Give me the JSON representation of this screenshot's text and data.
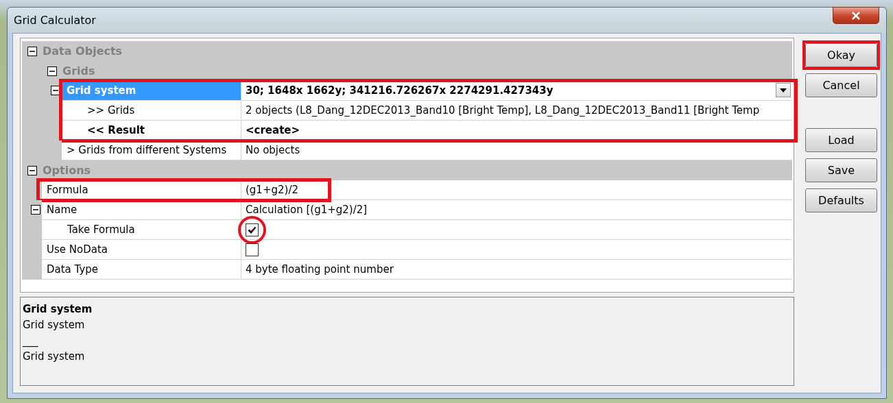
{
  "window": {
    "title": "Grid Calculator"
  },
  "properties": [
    {
      "kind": "category",
      "label": "Data Objects",
      "expanded": true,
      "children": [
        {
          "kind": "category",
          "label": "Grids",
          "expanded": true,
          "children": [
            {
              "kind": "dropdown",
              "label": "Grid system",
              "value": "30; 1648x 1662y; 341216.726267x 2274291.427343y",
              "bold": true,
              "selected": true,
              "expanded": true,
              "highlighted": true,
              "highlight_full_width": true,
              "children": [
                {
                  "kind": "text",
                  "label": ">> Grids",
                  "value": "2 objects (L8_Dang_12DEC2013_Band10 [Bright Temp], L8_Dang_12DEC2013_Band11 [Bright Temp",
                  "bold": false,
                  "selected": false,
                  "highlighted": true,
                  "highlight_full_width": true
                },
                {
                  "kind": "text",
                  "label": "<< Result",
                  "value": "<create>",
                  "bold": true,
                  "selected": false,
                  "highlighted": true,
                  "highlight_full_width": true
                }
              ]
            },
            {
              "kind": "text",
              "label": "> Grids from different Systems",
              "value": "No objects",
              "bold": false,
              "selected": false,
              "highlighted": false
            }
          ]
        }
      ]
    },
    {
      "kind": "category",
      "label": "Options",
      "expanded": true,
      "children": [
        {
          "kind": "text",
          "label": "Formula",
          "value": "(g1+g2)/2",
          "bold": false,
          "selected": false,
          "highlighted": true,
          "highlight_full_width": false
        },
        {
          "kind": "text",
          "label": "Name",
          "value": "Calculation [(g1+g2)/2]",
          "bold": false,
          "selected": false,
          "highlighted": false,
          "expanded": true,
          "children": [
            {
              "kind": "checkbox",
              "label": "Take Formula",
              "checked": true,
              "circled": true,
              "selected": false,
              "highlighted": false
            }
          ]
        },
        {
          "kind": "checkbox",
          "label": "Use NoData",
          "checked": false,
          "selected": false,
          "highlighted": false
        },
        {
          "kind": "text",
          "label": "Data Type",
          "value": "4 byte floating point number",
          "bold": false,
          "selected": false,
          "highlighted": false
        }
      ]
    }
  ],
  "help": {
    "title": "Grid system",
    "lines": [
      "Grid system",
      "___",
      "Grid system"
    ]
  },
  "button_groups": [
    {
      "buttons": [
        {
          "label": "Okay",
          "highlighted": true
        },
        {
          "label": "Cancel",
          "highlighted": false
        }
      ]
    },
    {
      "buttons": [
        {
          "label": "Load",
          "highlighted": false
        },
        {
          "label": "Save",
          "highlighted": false
        },
        {
          "label": "Defaults",
          "highlighted": false
        }
      ]
    }
  ]
}
